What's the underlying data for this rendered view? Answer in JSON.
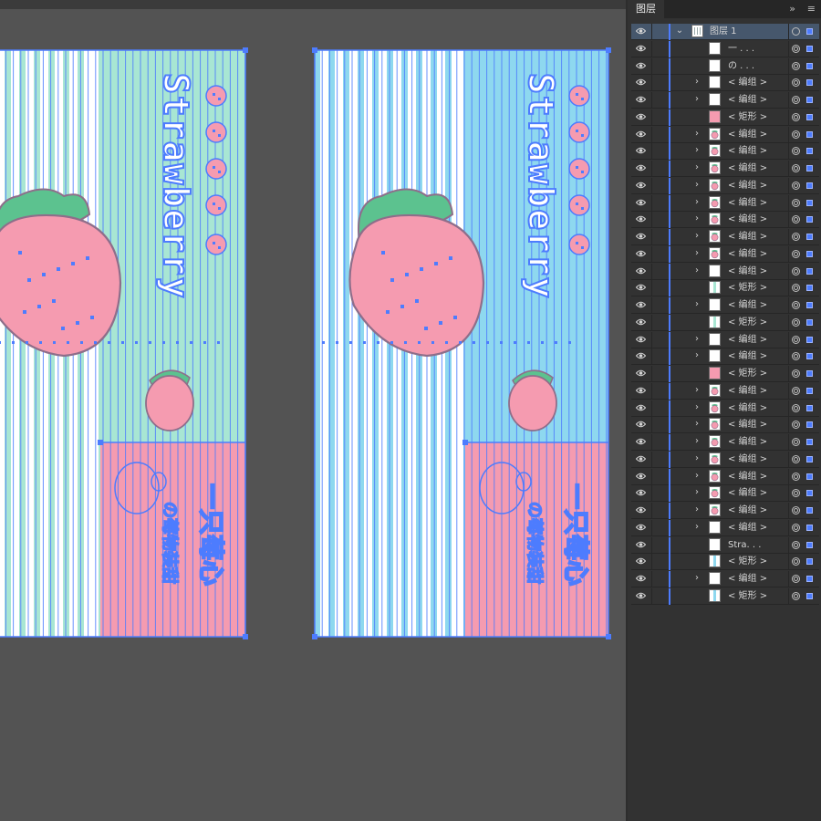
{
  "panel": {
    "tab_label": "图层",
    "expand_icon": "double-chevron-right-icon",
    "menu_icon": "hamburger-menu-icon",
    "accent_color": "#4d7cfe"
  },
  "layers": [
    {
      "label": "图层 1",
      "level": 0,
      "expandable": true,
      "thumb": "white",
      "target": "plain",
      "selected": true
    },
    {
      "label": "一 . . .",
      "level": 1,
      "expandable": false,
      "thumb": "white",
      "target": "ring"
    },
    {
      "label": "の . . .",
      "level": 1,
      "expandable": false,
      "thumb": "white",
      "target": "ring"
    },
    {
      "label": "< 编组 >",
      "level": 1,
      "expandable": true,
      "thumb": "white",
      "target": "ring"
    },
    {
      "label": "< 编组 >",
      "level": 1,
      "expandable": true,
      "thumb": "white",
      "target": "ring"
    },
    {
      "label": "< 矩形 >",
      "level": 1,
      "expandable": false,
      "thumb": "pink",
      "target": "ring"
    },
    {
      "label": "< 编组 >",
      "level": 1,
      "expandable": true,
      "thumb": "strawberry",
      "target": "ring"
    },
    {
      "label": "< 编组 >",
      "level": 1,
      "expandable": true,
      "thumb": "strawberry",
      "target": "ring"
    },
    {
      "label": "< 编组 >",
      "level": 1,
      "expandable": true,
      "thumb": "strawberry",
      "target": "ring"
    },
    {
      "label": "< 编组 >",
      "level": 1,
      "expandable": true,
      "thumb": "strawberry",
      "target": "ring"
    },
    {
      "label": "< 编组 >",
      "level": 1,
      "expandable": true,
      "thumb": "strawberry",
      "target": "ring"
    },
    {
      "label": "< 编组 >",
      "level": 1,
      "expandable": true,
      "thumb": "strawberry",
      "target": "ring"
    },
    {
      "label": "< 编组 >",
      "level": 1,
      "expandable": true,
      "thumb": "strawberry",
      "target": "ring"
    },
    {
      "label": "< 编组 >",
      "level": 1,
      "expandable": true,
      "thumb": "strawberry",
      "target": "ring"
    },
    {
      "label": "< 编组 >",
      "level": 1,
      "expandable": true,
      "thumb": "white",
      "target": "ring"
    },
    {
      "label": "< 矩形 >",
      "level": 1,
      "expandable": false,
      "thumb": "green-stripe",
      "target": "ring"
    },
    {
      "label": "< 编组 >",
      "level": 1,
      "expandable": true,
      "thumb": "white",
      "target": "ring"
    },
    {
      "label": "< 矩形 >",
      "level": 1,
      "expandable": false,
      "thumb": "green-stripe",
      "target": "ring"
    },
    {
      "label": "< 编组 >",
      "level": 1,
      "expandable": true,
      "thumb": "white",
      "target": "ring"
    },
    {
      "label": "< 编组 >",
      "level": 1,
      "expandable": true,
      "thumb": "white",
      "target": "ring"
    },
    {
      "label": "< 矩形 >",
      "level": 1,
      "expandable": false,
      "thumb": "pink",
      "target": "ring"
    },
    {
      "label": "< 编组 >",
      "level": 1,
      "expandable": true,
      "thumb": "strawberry",
      "target": "ring"
    },
    {
      "label": "< 编组 >",
      "level": 1,
      "expandable": true,
      "thumb": "strawberry",
      "target": "ring"
    },
    {
      "label": "< 编组 >",
      "level": 1,
      "expandable": true,
      "thumb": "strawberry",
      "target": "ring"
    },
    {
      "label": "< 编组 >",
      "level": 1,
      "expandable": true,
      "thumb": "strawberry",
      "target": "ring"
    },
    {
      "label": "< 编组 >",
      "level": 1,
      "expandable": true,
      "thumb": "strawberry",
      "target": "ring"
    },
    {
      "label": "< 编组 >",
      "level": 1,
      "expandable": true,
      "thumb": "strawberry",
      "target": "ring"
    },
    {
      "label": "< 编组 >",
      "level": 1,
      "expandable": true,
      "thumb": "strawberry",
      "target": "ring"
    },
    {
      "label": "< 编组 >",
      "level": 1,
      "expandable": true,
      "thumb": "strawberry",
      "target": "ring"
    },
    {
      "label": "< 编组 >",
      "level": 1,
      "expandable": true,
      "thumb": "white",
      "target": "ring"
    },
    {
      "label": "Stra. . .",
      "level": 1,
      "expandable": false,
      "thumb": "white",
      "target": "ring"
    },
    {
      "label": "< 矩形 >",
      "level": 1,
      "expandable": false,
      "thumb": "blue-stripe",
      "target": "ring"
    },
    {
      "label": "< 编组 >",
      "level": 1,
      "expandable": true,
      "thumb": "white",
      "target": "ring"
    },
    {
      "label": "< 矩形 >",
      "level": 1,
      "expandable": false,
      "thumb": "blue-stripe",
      "target": "ring"
    }
  ],
  "artboards": [
    {
      "bg_color": "#a8e6d3",
      "theme": "mint"
    },
    {
      "bg_color": "#8ed8ef",
      "theme": "sky"
    }
  ],
  "artwork_text": {
    "title": "Strawberry",
    "subtitle": "一只莓心",
    "caption": "の莓物装甜"
  },
  "colors": {
    "pink": "#f59bb0",
    "leaf": "#5cc28f",
    "stroke": "#8e6e8a",
    "selection": "#4d7cfe"
  }
}
